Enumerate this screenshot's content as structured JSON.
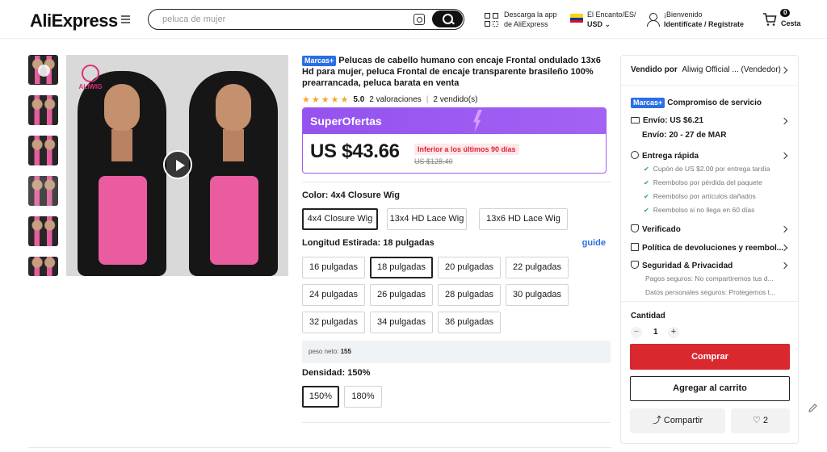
{
  "header": {
    "logo": "AliExpress",
    "search": {
      "placeholder": "peluca de mujer"
    },
    "app": {
      "line1": "Descarga la app",
      "line2": "de AliExpress"
    },
    "locale": {
      "line1": "El Encanto/ES/",
      "line2": "USD"
    },
    "account": {
      "line1": "¡Bienvenido",
      "line2": "Identifícate / Regístrate"
    },
    "cart": {
      "count": "0",
      "label": "Cesta"
    }
  },
  "gallery": {
    "brand_text": "ALIWIG",
    "thumbnail_count": 6
  },
  "product": {
    "badge": "Marcas+",
    "title": "Pelucas de cabello humano con encaje Frontal ondulado 13x6 Hd para mujer, peluca Frontal de encaje transparente brasileño 100% prearrancada, peluca barata en venta",
    "rating": "5.0",
    "reviews": "2 valoraciones",
    "sold": "2 vendido(s)",
    "deal": {
      "label": "SuperOfertas",
      "price": "US $43.66",
      "note": "Inferior a los últimos 90 días",
      "old_price": "US $128.40"
    },
    "color": {
      "label": "Color: 4x4 Closure Wig",
      "options": [
        "4x4 Closure Wig",
        "13x4 HD Lace Wig",
        "13x6 HD Lace Wig"
      ],
      "selected": 0
    },
    "length": {
      "label": "Longitud Estirada: 18 pulgadas",
      "guide": "guide",
      "options": [
        "16 pulgadas",
        "18 pulgadas",
        "20 pulgadas",
        "22 pulgadas",
        "24 pulgadas",
        "26 pulgadas",
        "28 pulgadas",
        "30 pulgadas",
        "32 pulgadas",
        "34 pulgadas",
        "36 pulgadas"
      ],
      "selected": 1
    },
    "weight": {
      "label": "peso neto:",
      "value": "155"
    },
    "density": {
      "label": "Densidad: 150%",
      "options": [
        "150%",
        "180%"
      ],
      "selected": 0
    }
  },
  "panel": {
    "seller_label": "Vendido por",
    "seller_name": "Aliwig Official ... (Vendedor)",
    "service_badge": "Marcas+",
    "service_title": "Compromiso de servicio",
    "shipping": "Envío: US $6.21",
    "delivery": "Envío: 20 - 27 de MAR",
    "fast_delivery": "Entrega rápida",
    "fast_items": [
      "Cupón de US $2.00 por entrega tardía",
      "Reembolso por pérdida del paquete",
      "Reembolso por artículos dañados",
      "Reembolso si no llega en 60 días"
    ],
    "verified": "Verificado",
    "returns": "Política de devoluciones y reembol...",
    "security": "Seguridad & Privacidad",
    "security_items": [
      "Pagos seguros: No compartiremos tus d...",
      "Datos personales seguros: Protegemos t..."
    ],
    "quantity_label": "Cantidad",
    "quantity": "1",
    "buy": "Comprar",
    "add_cart": "Agregar al carrito",
    "share": "Compartir",
    "likes": "2"
  },
  "colors": {
    "deal_purple": "#9452ef",
    "buy_red": "#d9282e",
    "plus_blue": "#2b6fe3",
    "star": "#f5a623"
  }
}
